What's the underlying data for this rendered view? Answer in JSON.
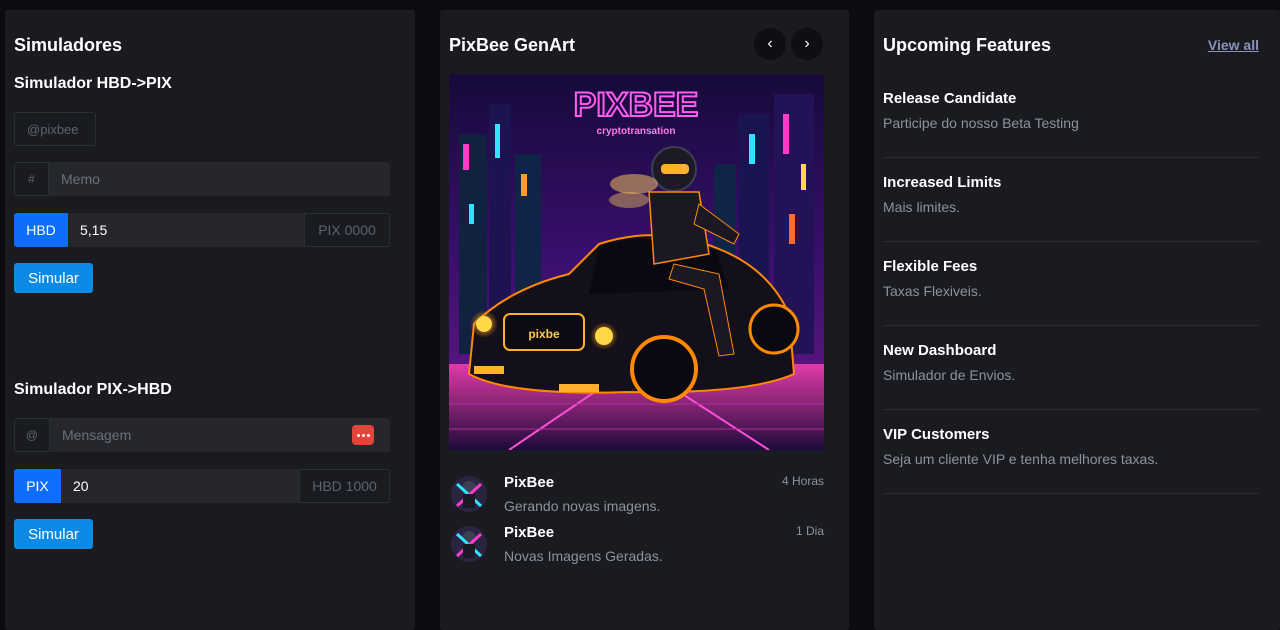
{
  "simulators": {
    "title": "Simuladores",
    "hbd_to_pix": {
      "title": "Simulador HBD->PIX",
      "username_placeholder": "@pixbee",
      "memo_addon": "#",
      "memo_placeholder": "Memo",
      "currency_tag": "HBD",
      "amount_value": "5,15",
      "result_placeholder": "PIX 0000",
      "button": "Simular"
    },
    "pix_to_hbd": {
      "title": "Simulador PIX->HBD",
      "message_addon": "@",
      "message_placeholder": "Mensagem",
      "currency_tag": "PIX",
      "amount_value": "20",
      "result_placeholder": "HBD 1000",
      "button": "Simular"
    }
  },
  "genart": {
    "title": "PixBee GenArt",
    "prev_icon": "‹",
    "next_icon": "›",
    "art": {
      "logo_text": "PIXBEE",
      "logo_subtext": "cryptotransation",
      "plate_text": "pixbe"
    },
    "feed": [
      {
        "name": "PixBee",
        "message": "Gerando novas imagens.",
        "time": "4 Horas"
      },
      {
        "name": "PixBee",
        "message": "Novas Imagens Geradas.",
        "time": "1 Dia"
      }
    ]
  },
  "features": {
    "title": "Upcoming Features",
    "view_all": "View all",
    "items": [
      {
        "name": "Release Candidate",
        "description": "Participe do nosso Beta Testing"
      },
      {
        "name": "Increased Limits",
        "description": "Mais limites."
      },
      {
        "name": "Flexible Fees",
        "description": "Taxas Flexiveis."
      },
      {
        "name": "New Dashboard",
        "description": "Simulador de Envios."
      },
      {
        "name": "VIP Customers",
        "description": "Seja um cliente VIP e tenha melhores taxas."
      }
    ]
  }
}
